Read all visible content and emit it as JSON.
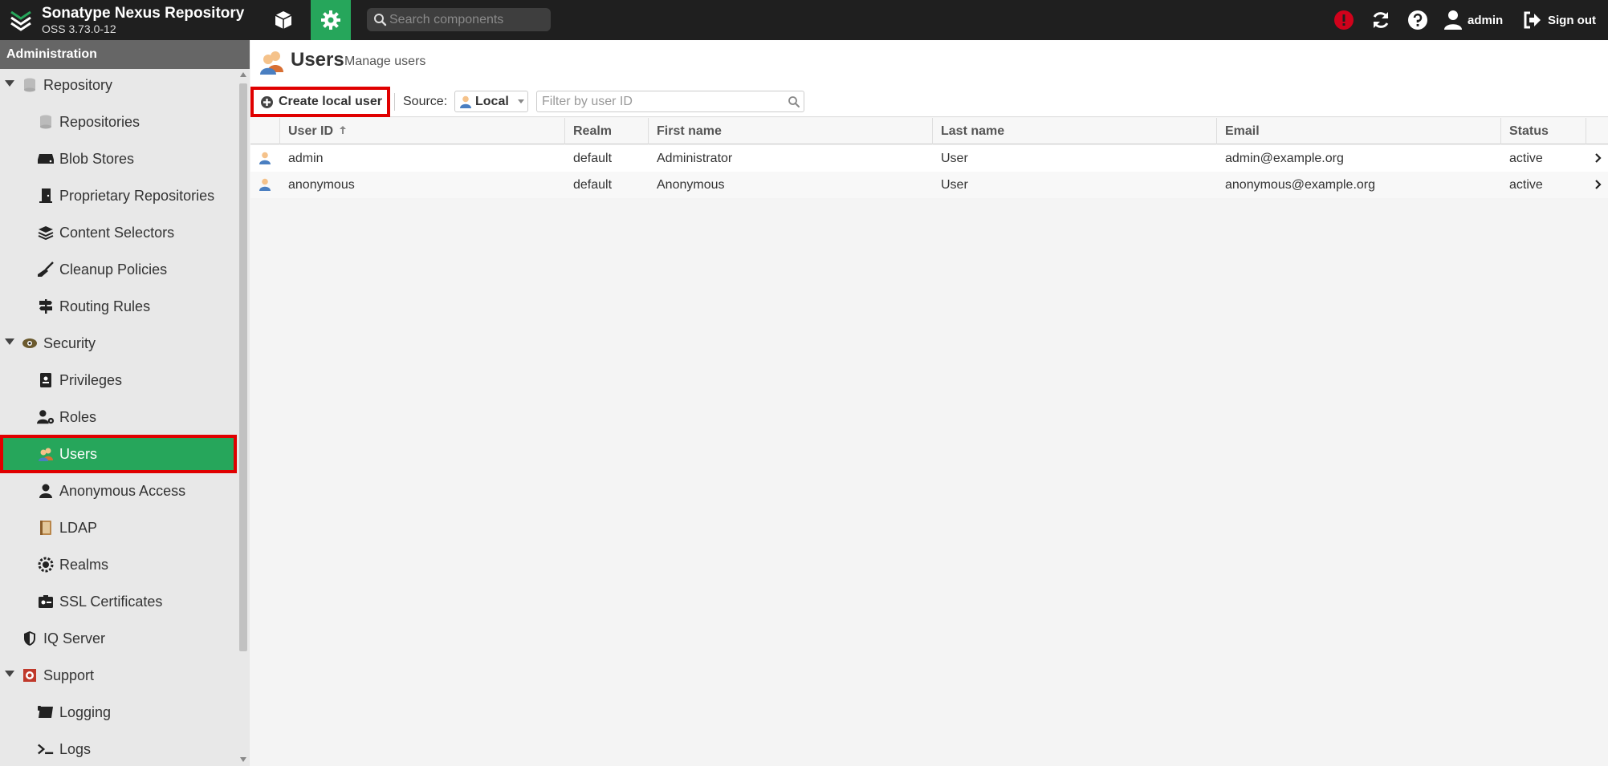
{
  "header": {
    "app_title": "Sonatype Nexus Repository",
    "version": "OSS 3.73.0-12",
    "search_placeholder": "Search components",
    "username": "admin",
    "signout_label": "Sign out"
  },
  "sidebar": {
    "title": "Administration",
    "items": [
      {
        "label": "Repository"
      },
      {
        "label": "Repositories"
      },
      {
        "label": "Blob Stores"
      },
      {
        "label": "Proprietary Repositories"
      },
      {
        "label": "Content Selectors"
      },
      {
        "label": "Cleanup Policies"
      },
      {
        "label": "Routing Rules"
      },
      {
        "label": "Security"
      },
      {
        "label": "Privileges"
      },
      {
        "label": "Roles"
      },
      {
        "label": "Users"
      },
      {
        "label": "Anonymous Access"
      },
      {
        "label": "LDAP"
      },
      {
        "label": "Realms"
      },
      {
        "label": "SSL Certificates"
      },
      {
        "label": "IQ Server"
      },
      {
        "label": "Support"
      },
      {
        "label": "Logging"
      },
      {
        "label": "Logs"
      }
    ]
  },
  "page": {
    "title": "Users",
    "subtitle": "Manage users"
  },
  "toolbar": {
    "create_label": "Create local user",
    "source_label": "Source:",
    "source_value": "Local",
    "filter_placeholder": "Filter by user ID"
  },
  "grid": {
    "columns": {
      "user_id": "User ID",
      "realm": "Realm",
      "first_name": "First name",
      "last_name": "Last name",
      "email": "Email",
      "status": "Status"
    },
    "rows": [
      {
        "user_id": "admin",
        "realm": "default",
        "first_name": "Administrator",
        "last_name": "User",
        "email": "admin@example.org",
        "status": "active"
      },
      {
        "user_id": "anonymous",
        "realm": "default",
        "first_name": "Anonymous",
        "last_name": "User",
        "email": "anonymous@example.org",
        "status": "active"
      }
    ]
  },
  "colors": {
    "accent": "#26a65b",
    "topbar": "#1f1f1f",
    "highlight": "#e00000",
    "alert": "#d0021b"
  }
}
